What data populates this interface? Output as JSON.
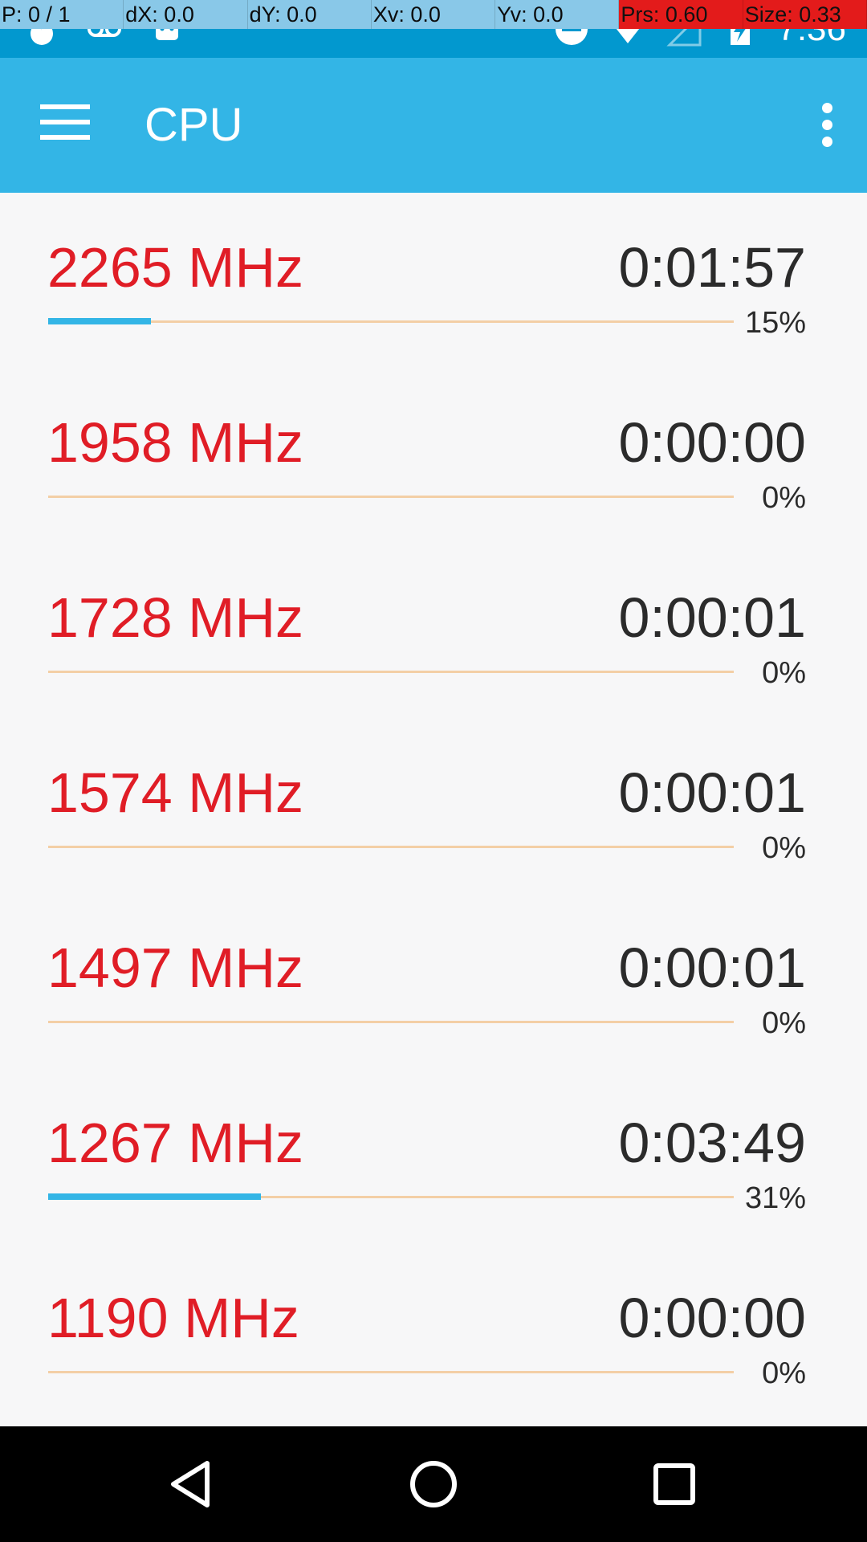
{
  "debug_overlay": [
    "P: 0 / 1",
    "dX: 0.0",
    "dY: 0.0",
    "Xv: 0.0",
    "Yv: 0.0",
    "Prs: 0.60",
    "Size: 0.33"
  ],
  "status_bar": {
    "time": "7:36"
  },
  "app_bar": {
    "title": "CPU"
  },
  "colors": {
    "accent": "#33b5e6",
    "frequency_text": "#e01d26",
    "track": "#f3cfa6"
  },
  "frequencies": [
    {
      "freq": "2265 MHz",
      "time": "0:01:57",
      "percent_label": "15%",
      "percent": 15
    },
    {
      "freq": "1958 MHz",
      "time": "0:00:00",
      "percent_label": "0%",
      "percent": 0
    },
    {
      "freq": "1728 MHz",
      "time": "0:00:01",
      "percent_label": "0%",
      "percent": 0
    },
    {
      "freq": "1574 MHz",
      "time": "0:00:01",
      "percent_label": "0%",
      "percent": 0
    },
    {
      "freq": "1497 MHz",
      "time": "0:00:01",
      "percent_label": "0%",
      "percent": 0
    },
    {
      "freq": "1267 MHz",
      "time": "0:03:49",
      "percent_label": "31%",
      "percent": 31
    },
    {
      "freq": "1190 MHz",
      "time": "0:00:00",
      "percent_label": "0%",
      "percent": 0
    }
  ]
}
